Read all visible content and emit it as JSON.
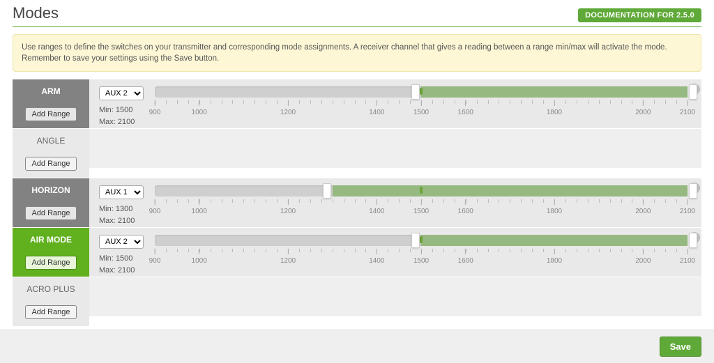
{
  "header": {
    "title": "Modes",
    "doc_button": "DOCUMENTATION FOR 2.5.0"
  },
  "info_text": "Use ranges to define the switches on your transmitter and corresponding mode assignments. A receiver channel that gives a reading between a range min/max will activate the mode. Remember to save your settings using the Save button.",
  "axis": {
    "min": 900,
    "max": 2100,
    "major": [
      900,
      1000,
      1200,
      1400,
      1500,
      1600,
      1800,
      2000,
      2100
    ]
  },
  "modes": [
    {
      "name": "ARM",
      "style": "gray",
      "add_label": "Add Range",
      "range": {
        "aux": "AUX 2",
        "min": 1500,
        "max": 2100,
        "pointer": 1500
      }
    },
    {
      "name": "ANGLE",
      "style": "light",
      "add_label": "Add Range",
      "range": null
    },
    {
      "name": "HORIZON",
      "style": "gray",
      "add_label": "Add Range",
      "range": {
        "aux": "AUX 1",
        "min": 1300,
        "max": 2100,
        "pointer": 1500
      }
    },
    {
      "name": "AIR MODE",
      "style": "green",
      "add_label": "Add Range",
      "range": {
        "aux": "AUX 2",
        "min": 1500,
        "max": 2100,
        "pointer": 1500
      }
    },
    {
      "name": "ACRO PLUS",
      "style": "light",
      "add_label": "Add Range",
      "range": null
    }
  ],
  "footer": {
    "save": "Save"
  },
  "labels": {
    "min_prefix": "Min: ",
    "max_prefix": "Max: "
  }
}
